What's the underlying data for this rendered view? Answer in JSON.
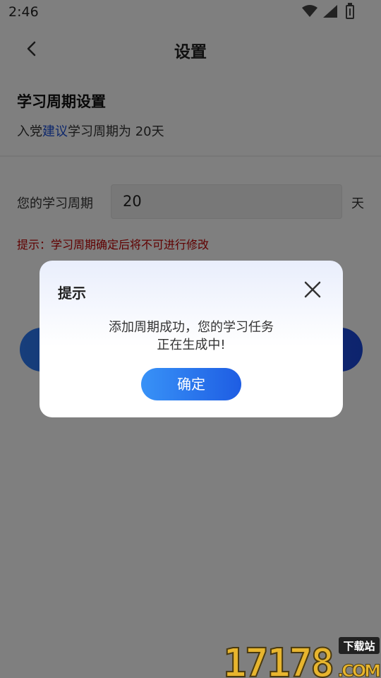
{
  "status_bar": {
    "time": "2:46"
  },
  "header": {
    "title": "设置"
  },
  "cycle_section": {
    "title": "学习周期设置",
    "subtitle_prefix": "入党",
    "subtitle_link": "建议",
    "subtitle_suffix": "学习周期为 20天"
  },
  "form": {
    "label": "您的学习周期",
    "value": "20",
    "unit": "天",
    "hint": "提示：学习周期确定后将不可进行修改"
  },
  "dialog": {
    "title": "提示",
    "message_line1": "添加周期成功，您的学习任务",
    "message_line2": "正在生成中!",
    "confirm_label": "确定"
  },
  "watermark": {
    "text": "17178",
    "sub": ".COM",
    "tag": "下载站"
  },
  "colors": {
    "accent": "#2e7cf6",
    "link": "#1a4fd8",
    "hint": "#c00000"
  },
  "icons": [
    "back-icon",
    "wifi-icon",
    "signal-icon",
    "battery-icon",
    "close-icon"
  ]
}
